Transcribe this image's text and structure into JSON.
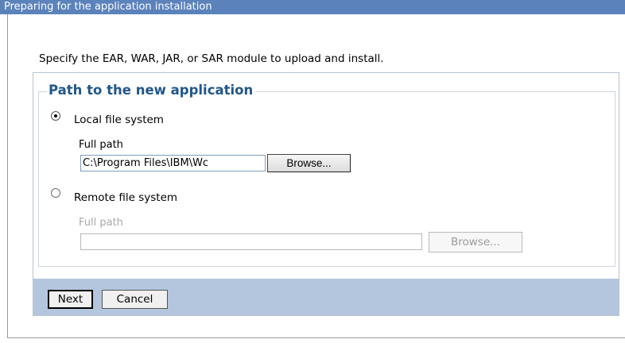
{
  "window": {
    "title": "Preparing for the application installation"
  },
  "intro_text": "Specify the EAR, WAR, JAR, or SAR module to upload and install.",
  "path_group": {
    "legend": "Path to the new application",
    "local": {
      "label": "Local file system",
      "selected": true,
      "full_path_label": "Full path",
      "full_path_value": "C:\\Program Files\\IBM\\Wc",
      "browse_label": "Browse..."
    },
    "remote": {
      "label": "Remote file system",
      "selected": false,
      "full_path_label": "Full path",
      "full_path_value": "",
      "browse_label": "Browse..."
    }
  },
  "buttons": {
    "next_label": "Next",
    "cancel_label": "Cancel"
  },
  "colors": {
    "title_bar": "#5b82bb",
    "legend_text": "#21578a",
    "footer_bar": "#b3c6de"
  }
}
